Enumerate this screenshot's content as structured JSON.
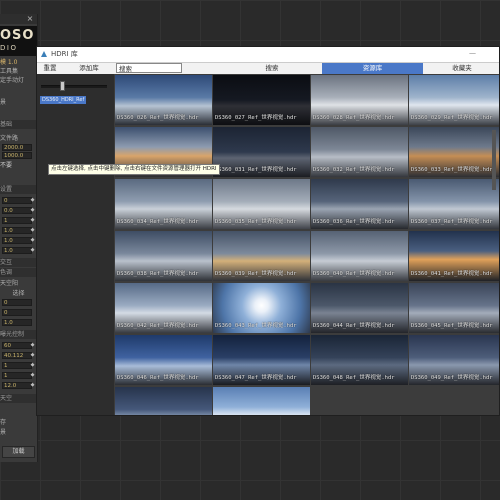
{
  "left_panel": {
    "close_glyph": "×",
    "logo_line1": "OSO",
    "logo_line2": "DIO",
    "rows": [
      {
        "text": "模 1.0"
      },
      {
        "text": "工具集"
      },
      {
        "text": "定手动灯"
      },
      {
        "text": "景"
      },
      {
        "text": "基础"
      },
      {
        "text": "文件路"
      }
    ],
    "sections": [
      {
        "text": "设置"
      },
      {
        "text": "交互"
      },
      {
        "text": "色调"
      },
      {
        "text": "天空"
      },
      {
        "text": "曝光控制"
      },
      {
        "text": "存"
      }
    ],
    "fields": [
      "2000.0",
      "1000.0",
      "0",
      "0.0",
      "1",
      "1.0",
      "1.0",
      "1.0",
      "0",
      "0",
      "1.0",
      "60",
      "40.112",
      "1",
      "1",
      "12.0"
    ],
    "misc": [
      "天空阳",
      "选择",
      "不要",
      "存",
      "景"
    ],
    "load_label": "加载"
  },
  "window": {
    "title": "HDRI 库",
    "min_glyph": "—",
    "tabs": [
      "重置",
      "添加库",
      "搜索",
      "资源库",
      "收藏夹"
    ],
    "active_tab_index": 3,
    "search_value": "搜索",
    "folder_label": "DS360_HDRI_Ref",
    "slider_value_fraction": 0.3
  },
  "tooltip": "点击左键选择, 点击中键删除, 点击右键在文件资源管理器打开 HDRI",
  "thumbnails": [
    {
      "label": "DS360_026_Ref_世界视觉.hdr",
      "sky": "linear-gradient(180deg,#2e4a78 0%,#5a7aa6 45%,#b6c3d2 62%,#2a2e36 100%)"
    },
    {
      "label": "DS360_027_Ref_世界视觉.hdr",
      "sky": "linear-gradient(180deg,#0b0d12 0%,#151922 50%,#2f3036 62%,#0d0e12 100%)"
    },
    {
      "label": "DS360_028_Ref_世界视觉.hdr",
      "sky": "linear-gradient(180deg,#6b7380 0%,#a9b0ba 45%,#dfe2e6 60%,#3b3e44 100%)"
    },
    {
      "label": "DS360_029_Ref_世界视觉.hdr",
      "sky": "linear-gradient(180deg,#5d7ea8 0%,#9fb4cc 45%,#dfe6ee 60%,#3d4148 100%)"
    },
    {
      "label": "DS360_030_Ref_世界视觉.hdr",
      "sky": "linear-gradient(180deg,#3c4f6e 0%,#8d9bb0 40%,#d9a46a 58%,#2c2e33 100%)"
    },
    {
      "label": "DS360_031_Ref_世界视觉.hdr",
      "sky": "linear-gradient(180deg,#1c2433 0%,#2e394d 50%,#5d6472 62%,#1b1d22 100%)"
    },
    {
      "label": "DS360_032_Ref_世界视觉.hdr",
      "sky": "linear-gradient(180deg,#4f5866 0%,#7d8796 45%,#b7bdc6 60%,#34373d 100%)"
    },
    {
      "label": "DS360_033_Ref_世界视觉.hdr",
      "sky": "linear-gradient(180deg,#3b4759 0%,#6e7a8c 40%,#c58e55 58%,#2d2f34 100%)"
    },
    {
      "label": "DS360_034_Ref_世界视觉.hdr",
      "sky": "linear-gradient(180deg,#5a6a80 0%,#8f9db0 45%,#c9d0d8 60%,#3a3d43 100%)"
    },
    {
      "label": "DS360_035_Ref_世界视觉.hdr",
      "sky": "linear-gradient(180deg,#6d7888 0%,#a4adb9 45%,#d6dadf 60%,#40434a 100%)"
    },
    {
      "label": "DS360_036_Ref_世界视觉.hdr",
      "sky": "linear-gradient(180deg,#2f3a4c 0%,#56647a 45%,#9aa4b2 60%,#26282d 100%)"
    },
    {
      "label": "DS360_037_Ref_世界视觉.hdr",
      "sky": "linear-gradient(180deg,#4a5a72 0%,#8494aa 45%,#c0c8d2 60%,#33363c 100%)"
    },
    {
      "label": "DS360_038_Ref_世界视觉.hdr",
      "sky": "linear-gradient(180deg,#3e4d64 0%,#7a889c 45%,#b9c1cc 60%,#2e3136 100%)"
    },
    {
      "label": "DS360_039_Ref_世界视觉.hdr",
      "sky": "linear-gradient(180deg,#455266 0%,#7d8a9c 45%,#d3b07a 60%,#303238 100%)"
    },
    {
      "label": "DS360_040_Ref_世界视觉.hdr",
      "sky": "linear-gradient(180deg,#566274 0%,#8d98a8 45%,#c6ccd4 60%,#383b41 100%)"
    },
    {
      "label": "DS360_041_Ref_世界视觉.hdr",
      "sky": "linear-gradient(180deg,#22324d 0%,#4a5f80 40%,#e0a15a 57%,#1f2126 100%)"
    },
    {
      "label": "DS360_042_Ref_世界视觉.hdr",
      "sky": "linear-gradient(180deg,#566a86 0%,#9aabc2 45%,#d4dbe4 60%,#373a40 100%)"
    },
    {
      "label": "DS360_043_Ref_世界视觉.hdr",
      "sky": "radial-gradient(circle at 50% 45%,#ffffff 0%,#eaf0f8 12%,#8fb0d8 35%,#4e75a8 70%,#2e3a4e 100%)"
    },
    {
      "label": "DS360_044_Ref_世界视觉.hdr",
      "sky": "linear-gradient(180deg,#2a3444 0%,#4c586a 45%,#7a8392 60%,#23252a 100%)"
    },
    {
      "label": "DS360_045_Ref_世界视觉.hdr",
      "sky": "linear-gradient(180deg,#3a4558 0%,#66738a 45%,#a3acba 60%,#2a2c31 100%)"
    },
    {
      "label": "DS360_046_Ref_世界视觉.hdr",
      "sky": "linear-gradient(180deg,#1f3a6a 0%,#3f62a0 45%,#a8bcd8 62%,#2a2d33 100%)"
    },
    {
      "label": "DS360_047_Ref_世界视觉.hdr",
      "sky": "linear-gradient(180deg,#13223d 0%,#2a3f66 45%,#6f86a8 60%,#1a1c21 100%)"
    },
    {
      "label": "DS360_048_Ref_世界视觉.hdr",
      "sky": "linear-gradient(180deg,#1a2536 0%,#344259 45%,#5c6a80 60%,#1d1f24 100%)"
    },
    {
      "label": "DS360_049_Ref_世界视觉.hdr",
      "sky": "linear-gradient(180deg,#2a3650 0%,#4d5d7a 45%,#8a98ae 60%,#24262b 100%)"
    },
    {
      "label": "",
      "sky": "linear-gradient(180deg,#27344c 0%,#45587a 45%,#8597b2 60%,#24272c 100%)"
    },
    {
      "label": "",
      "sky": "linear-gradient(180deg,#5a7fb4 0%,#8fb0d8 40%,#d6e2f0 55%,#3a3f48 100%)"
    }
  ]
}
